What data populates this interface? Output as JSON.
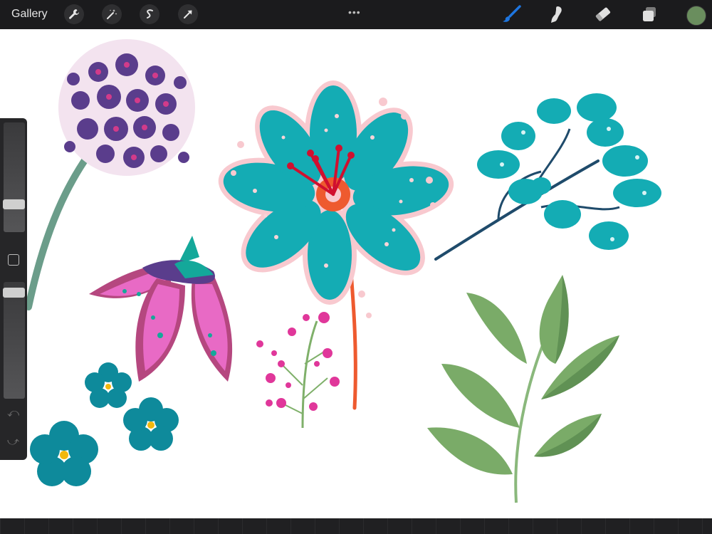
{
  "app": {
    "gallery_label": "Gallery",
    "more_label": "•••",
    "current_color": "#6a8e5e"
  },
  "toolbar_left": {
    "icons": [
      "wrench-icon",
      "magic-wand-icon",
      "selection-s-icon",
      "transform-arrow-icon"
    ]
  },
  "toolbar_right": {
    "icons": [
      "brush-icon",
      "smudge-icon",
      "eraser-icon",
      "layers-icon"
    ],
    "active_tool": "brush",
    "accent": "#1e76e0"
  },
  "sidebar": {
    "brush_size_level": 0.75,
    "opacity_level": 0.08,
    "icons": [
      "modify-square-icon",
      "undo-icon",
      "redo-icon"
    ]
  }
}
